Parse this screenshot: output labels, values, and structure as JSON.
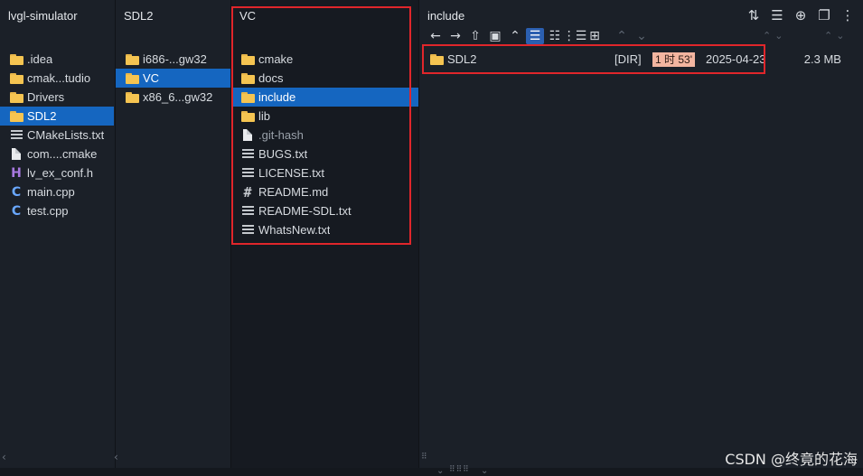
{
  "columns": [
    {
      "title": "lvgl-simulator",
      "items": [
        {
          "label": ".idea",
          "icon": "folder-icon"
        },
        {
          "label": "cmak...tudio",
          "icon": "folder-icon"
        },
        {
          "label": "Drivers",
          "icon": "folder-icon"
        },
        {
          "label": "SDL2",
          "icon": "folder-icon",
          "selected": true
        },
        {
          "label": "CMakeLists.txt",
          "icon": "text-file-icon"
        },
        {
          "label": "com....cmake",
          "icon": "file-icon"
        },
        {
          "label": "lv_ex_conf.h",
          "icon": "header-file-icon"
        },
        {
          "label": "main.cpp",
          "icon": "cpp-file-icon"
        },
        {
          "label": "test.cpp",
          "icon": "cpp-file-icon"
        }
      ]
    },
    {
      "title": "SDL2",
      "items": [
        {
          "label": "i686-...gw32",
          "icon": "folder-icon"
        },
        {
          "label": "VC",
          "icon": "folder-icon",
          "selected": true
        },
        {
          "label": "x86_6...gw32",
          "icon": "folder-icon"
        }
      ]
    },
    {
      "title": "VC",
      "items": [
        {
          "label": "cmake",
          "icon": "folder-icon"
        },
        {
          "label": "docs",
          "icon": "folder-icon"
        },
        {
          "label": "include",
          "icon": "folder-icon",
          "selected": true
        },
        {
          "label": "lib",
          "icon": "folder-icon"
        },
        {
          "label": ".git-hash",
          "icon": "file-icon"
        },
        {
          "label": "BUGS.txt",
          "icon": "text-file-icon"
        },
        {
          "label": "LICENSE.txt",
          "icon": "text-file-icon"
        },
        {
          "label": "README.md",
          "icon": "markdown-file-icon"
        },
        {
          "label": "README-SDL.txt",
          "icon": "text-file-icon"
        },
        {
          "label": "WhatsNew.txt",
          "icon": "text-file-icon"
        }
      ]
    }
  ],
  "detail": {
    "title": "include",
    "entries": [
      {
        "name": "SDL2",
        "type": "[DIR]",
        "time": "1 时 53'",
        "date": "2025-04-23",
        "size": "2.3 MB"
      }
    ]
  },
  "toolbar": {
    "icons": [
      "arrow-left-icon",
      "arrow-right-icon",
      "arrow-up-icon",
      "new-folder-icon",
      "chevron-up-icon",
      "list-view-icon",
      "detail-view-icon",
      "tree-view-icon",
      "grid-view-icon"
    ],
    "active": "list-view-icon"
  },
  "top_icons": [
    "sort-icon",
    "list-settings-icon",
    "add-icon",
    "copy-icon",
    "more-icon"
  ],
  "colors": {
    "background": "#1b2028",
    "selection": "#1566c0",
    "folder": "#f5c451",
    "highlight_box": "#e0262b",
    "time_badge": "#f3b5a0"
  },
  "watermark": "CSDN @终竟的花海"
}
